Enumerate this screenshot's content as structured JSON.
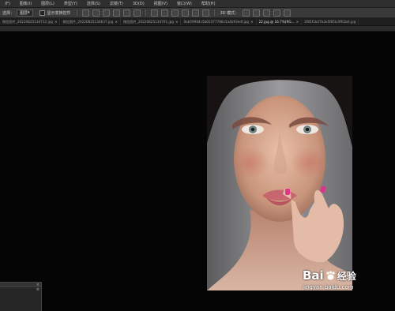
{
  "menubar": {
    "items": [
      "(F)",
      "图像(I)",
      "图层(L)",
      "类型(Y)",
      "选择(S)",
      "滤镜(T)",
      "3D(D)",
      "视图(V)",
      "窗口(W)",
      "帮助(H)"
    ]
  },
  "options_bar": {
    "select_label": "选择：",
    "select_value": "图层",
    "show_transform": "显示变换控件",
    "mode_3d": "3D 模式："
  },
  "tabs": [
    "微信图片_20220825134712.jpg",
    "微信图片_20220825134637.jpg",
    "微信图片_20220825134701.jpg",
    "9ab59984c5b02377788c5a4b93edf.jpg",
    "22.jpg @ 16.7%(RG...",
    "2f85f1b47b3e5f6f3c9f61b6.jpg"
  ],
  "panel": {
    "close": "×",
    "menu": "≡"
  },
  "watermark": {
    "brand_1": "Bai",
    "brand_2": "经验",
    "url": "jingyan.baidu.com"
  },
  "colors": {
    "menubar_bg": "#2f2f2f",
    "canvas_bg": "#050505"
  }
}
